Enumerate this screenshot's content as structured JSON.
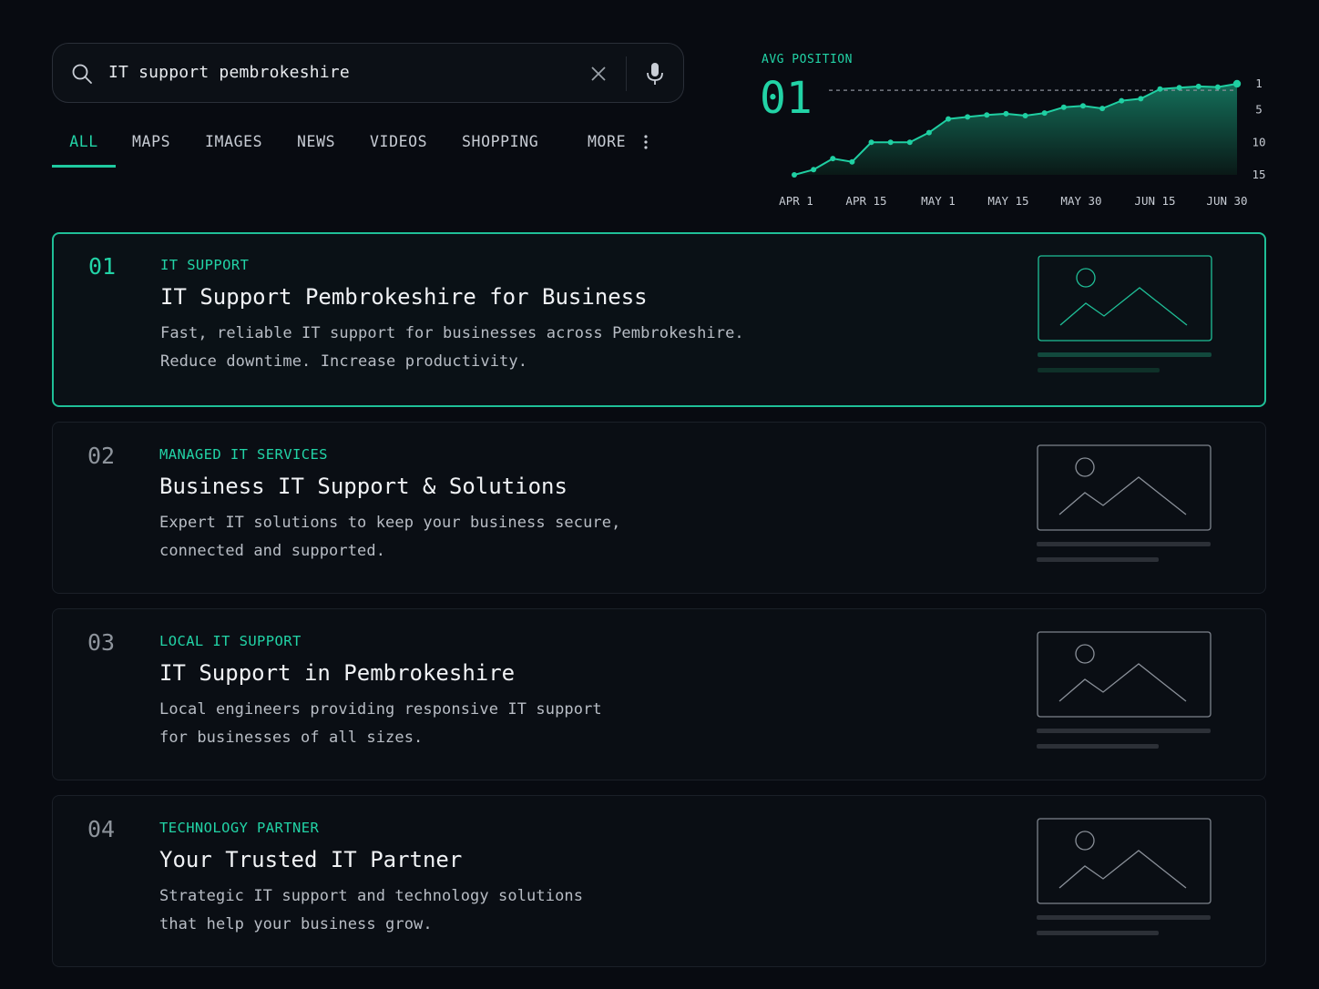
{
  "search": {
    "query": "IT support pembrokeshire",
    "icons": {
      "search": "search-icon",
      "clear": "close-icon",
      "voice": "microphone-icon"
    }
  },
  "tabs": [
    {
      "label": "ALL",
      "active": true
    },
    {
      "label": "MAPS"
    },
    {
      "label": "IMAGES"
    },
    {
      "label": "NEWS"
    },
    {
      "label": "VIDEOS"
    },
    {
      "label": "SHOPPING"
    },
    {
      "label": "MORE",
      "icon": "more-vertical-icon"
    }
  ],
  "avg_position": {
    "label": "AVG POSITION",
    "value": "01"
  },
  "chart_data": {
    "type": "area",
    "x": [
      "APR 1",
      "APR 4",
      "APR 8",
      "APR 12",
      "APR 15",
      "APR 19",
      "APR 23",
      "APR 27",
      "MAY 1",
      "MAY 4",
      "MAY 8",
      "MAY 12",
      "MAY 15",
      "MAY 20",
      "MAY 25",
      "MAY 30",
      "JUN 3",
      "JUN 7",
      "JUN 11",
      "JUN 15",
      "JUN 19",
      "JUN 23",
      "JUN 27",
      "JUN 30"
    ],
    "tick_labels": [
      "APR 1",
      "APR 15",
      "MAY 1",
      "MAY 15",
      "MAY 30",
      "JUN 15",
      "JUN 30"
    ],
    "y_ticks": [
      "1",
      "5",
      "10",
      "15"
    ],
    "series": [
      {
        "values": [
          15,
          14.2,
          12.5,
          13,
          10,
          10,
          10,
          8.5,
          6.4,
          6.1,
          5.8,
          5.6,
          5.9,
          5.5,
          4.6,
          4.4,
          4.8,
          3.6,
          3.3,
          1.8,
          1.6,
          1.4,
          1.5,
          1
        ]
      }
    ],
    "ylim": [
      15,
      1
    ],
    "y_inverted": true,
    "target_line": 2,
    "colors": {
      "line": "#1fcfa2",
      "fill_top": "#157a62",
      "fill_bottom": "#0a1a17"
    }
  },
  "results": [
    {
      "num": "01",
      "category": "IT SUPPORT",
      "title": "IT Support Pembrokeshire for Business",
      "desc": "Fast, reliable IT support for businesses across Pembrokeshire.\nReduce downtime. Increase productivity.",
      "active": true
    },
    {
      "num": "02",
      "category": "MANAGED IT SERVICES",
      "title": "Business IT Support & Solutions",
      "desc": "Expert IT solutions to keep your business secure,\nconnected and supported."
    },
    {
      "num": "03",
      "category": "LOCAL IT SUPPORT",
      "title": "IT Support in Pembrokeshire",
      "desc": "Local engineers providing responsive IT support\nfor businesses of all sizes."
    },
    {
      "num": "04",
      "category": "TECHNOLOGY PARTNER",
      "title": "Your Trusted IT Partner",
      "desc": "Strategic IT support and technology solutions\nthat help your business grow."
    }
  ],
  "colors": {
    "accent": "#22d3a6",
    "background": "#080b11",
    "card_border": "#1b2028"
  }
}
